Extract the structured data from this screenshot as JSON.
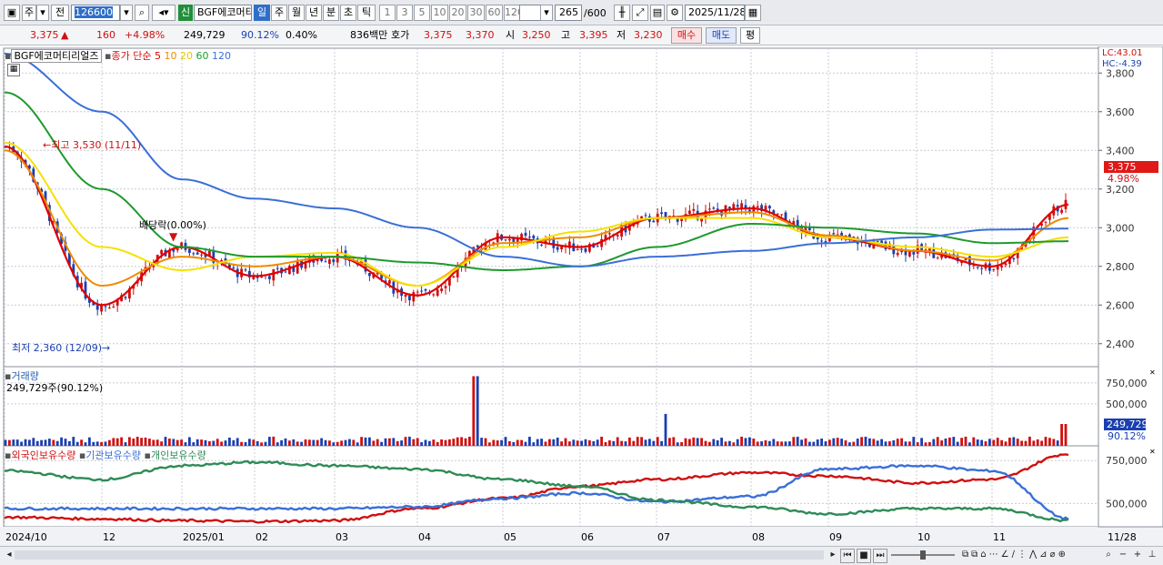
{
  "toolbar": {
    "period_main": "주",
    "prev_label": "전",
    "code": "126600",
    "new_label": "신",
    "name": "BGF에코머티",
    "periods": [
      "일",
      "주",
      "월",
      "년",
      "분",
      "초",
      "틱"
    ],
    "active_period": "일",
    "nums": [
      "1",
      "3",
      "5",
      "10",
      "20",
      "30",
      "60",
      "120"
    ],
    "count_value": "265",
    "count_total": "/600",
    "date": "2025/11/28"
  },
  "quote": {
    "price": "3,375",
    "change": "160",
    "change_pct": "+4.98%",
    "volume": "249,729",
    "volume_ratio": "90.12%",
    "turnover": "0.40%",
    "amount": "836백만",
    "bid_label": "호가",
    "ask": "3,375",
    "bid": "3,370",
    "open_label": "시",
    "open": "3,250",
    "high_label": "고",
    "high": "3,395",
    "low_label": "저",
    "low": "3,230",
    "buy_label": "매수",
    "sell_label": "매도",
    "avg_label": "평"
  },
  "price_panel": {
    "stock_label": "BGF에코머티리얼즈",
    "ma_title": "종가 단순",
    "ma_periods": [
      "5",
      "10",
      "20",
      "60",
      "120"
    ],
    "lc": "LC:43.01",
    "hc": "HC:-4.39",
    "y_ticks": [
      "3,800",
      "3,600",
      "3,400",
      "3,200",
      "3,000",
      "2,800",
      "2,600",
      "2,400"
    ],
    "y_tick_values": [
      3800,
      3600,
      3400,
      3200,
      3000,
      2800,
      2600,
      2400
    ],
    "high_note": "최고 3,530 (11/11)",
    "low_note": "최저 2,360 (12/09)",
    "div_note": "배당락(0.00%)",
    "price_tag": "3,375",
    "pct_tag": "4.98%"
  },
  "volume_panel": {
    "title": "거래량",
    "value": "249,729주(90.12%)",
    "y_ticks": [
      "750,000",
      "500,000"
    ],
    "tag_value": "249,729",
    "tag_pct": "90.12%"
  },
  "holding_panel": {
    "legend": [
      "외국인보유수량",
      "기관보유수량",
      "개인보유수량"
    ],
    "y_ticks": [
      "750,000",
      "500,000"
    ]
  },
  "x_axis": [
    "2024/10",
    "12",
    "2025/01",
    "02",
    "03",
    "04",
    "05",
    "06",
    "07",
    "08",
    "09",
    "10",
    "11"
  ],
  "x_axis_end": "11/28",
  "colors": {
    "up": "#d01010",
    "down": "#1a3fb0",
    "ma5": "#e00000",
    "ma10": "#f08a00",
    "ma20": "#f5e100",
    "ma60": "#1e9a2e",
    "ma120": "#3a6fd8",
    "foreign": "#d01010",
    "institution": "#3a6fd8",
    "individual": "#2e8b57"
  },
  "chart_data": {
    "type": "line",
    "title": "",
    "ylim": [
      2300,
      3900
    ],
    "x": [
      "2024/10",
      "12",
      "2025/01",
      "02",
      "03",
      "04",
      "05",
      "06",
      "07",
      "08",
      "09",
      "10",
      "11",
      "11/28"
    ],
    "series": [
      {
        "name": "5",
        "values": [
          3420,
          2600,
          2900,
          2750,
          2850,
          2650,
          2950,
          2900,
          3050,
          3100,
          2950,
          2880,
          2800,
          3120
        ]
      },
      {
        "name": "10",
        "values": [
          3400,
          2700,
          2850,
          2800,
          2850,
          2700,
          2920,
          2950,
          3050,
          3080,
          2960,
          2880,
          2830,
          3050
        ]
      },
      {
        "name": "20",
        "values": [
          3440,
          2900,
          2780,
          2850,
          2870,
          2700,
          2900,
          2980,
          3050,
          3050,
          2950,
          2900,
          2850,
          2950
        ]
      },
      {
        "name": "60",
        "values": [
          3700,
          3200,
          2900,
          2850,
          2850,
          2820,
          2780,
          2800,
          2900,
          3020,
          3000,
          2970,
          2920,
          2930
        ]
      },
      {
        "name": "120",
        "values": [
          3900,
          3600,
          3250,
          3150,
          3100,
          3000,
          2850,
          2800,
          2850,
          2880,
          2920,
          2950,
          2990,
          2995
        ]
      }
    ]
  }
}
